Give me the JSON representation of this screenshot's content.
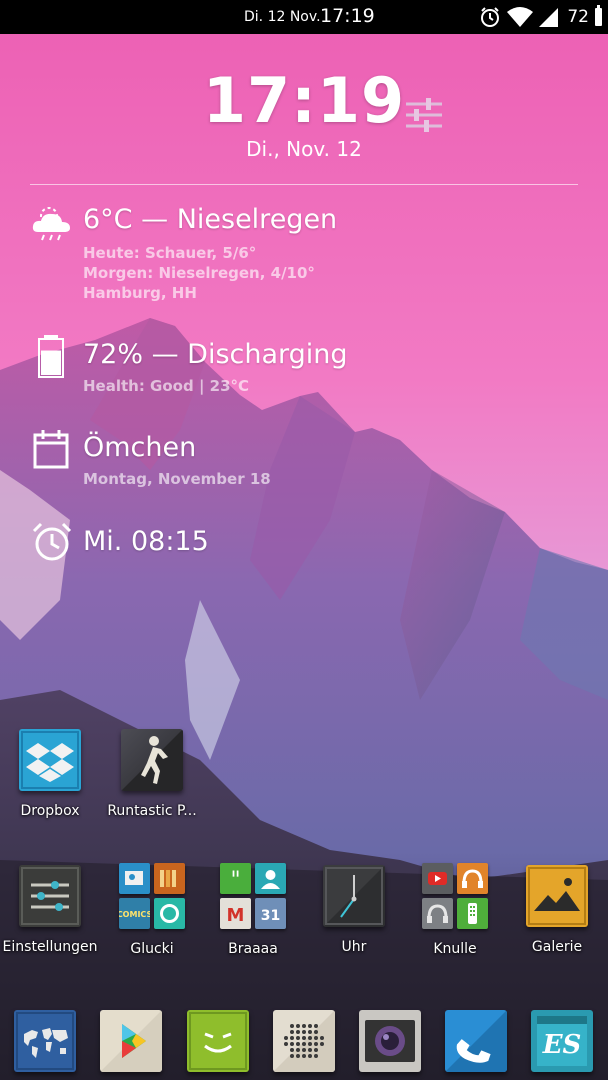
{
  "status_bar": {
    "date": "Di. 12 Nov.",
    "time": "17:19",
    "battery": "72",
    "icons": [
      "alarm-icon",
      "wifi-icon",
      "signal-icon",
      "battery-icon"
    ]
  },
  "clock_widget": {
    "time": "17:19",
    "date": "Di., Nov. 12",
    "settings_icon": "sliders-icon"
  },
  "weather": {
    "icon": "cloud-rain-icon",
    "title": "6°C — Nieselregen",
    "lines": [
      "Heute: Schauer, 5/6°",
      "Morgen: Nieselregen, 4/10°",
      "Hamburg, HH"
    ]
  },
  "battery": {
    "icon": "battery-icon",
    "title": "72% — Discharging",
    "level": 0.72,
    "sub": "Health: Good | 23°C"
  },
  "calendar": {
    "icon": "calendar-icon",
    "title": "Ömchen",
    "sub": "Montag, November 18"
  },
  "alarm": {
    "icon": "alarm-clock-icon",
    "title": "Mi. 08:15"
  },
  "apps_row1": [
    {
      "label": "Dropbox",
      "icon": "dropbox-icon"
    },
    {
      "label": "Runtastic P...",
      "icon": "runner-icon"
    }
  ],
  "apps_row2": [
    {
      "label": "Einstellungen",
      "icon": "settings-sliders-icon"
    },
    {
      "label": "Glucki",
      "icon": "folder-icon"
    },
    {
      "label": "Braaaa",
      "icon": "folder-icon"
    },
    {
      "label": "Uhr",
      "icon": "clock-icon"
    },
    {
      "label": "Knulle",
      "icon": "folder-icon"
    },
    {
      "label": "Galerie",
      "icon": "gallery-icon"
    }
  ],
  "dock": [
    {
      "icon": "world-map-icon"
    },
    {
      "icon": "play-store-icon"
    },
    {
      "icon": "face-icon"
    },
    {
      "icon": "speaker-grid-icon"
    },
    {
      "icon": "camera-icon"
    },
    {
      "icon": "phone-icon"
    },
    {
      "icon": "es-file-explorer-icon",
      "text": "ES"
    }
  ],
  "colors": {
    "sky_top": "#f06ab8",
    "sky_bottom": "#d99ad8",
    "mountain": "#7a5a9a",
    "statusbar": "#000000"
  }
}
